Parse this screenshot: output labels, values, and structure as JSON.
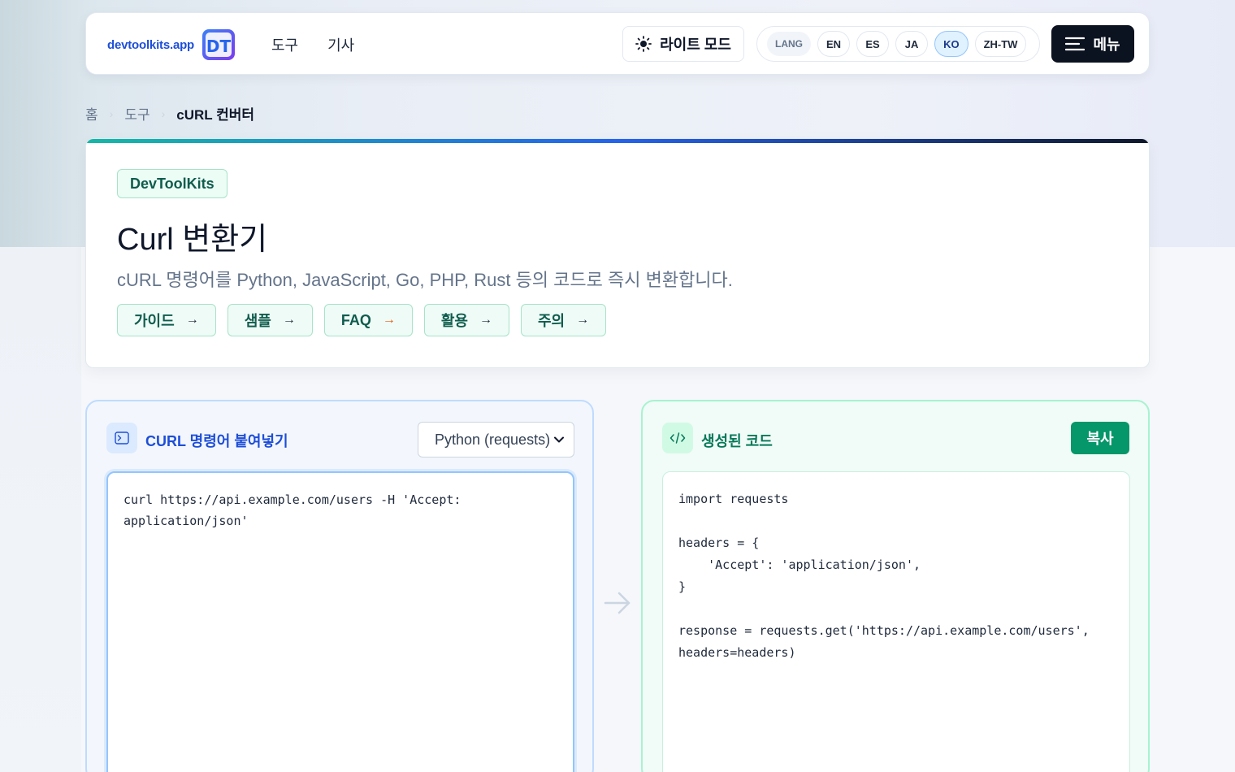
{
  "header": {
    "brand": "devtoolkits.app",
    "logo_text": "DT",
    "nav": [
      "도구",
      "기사"
    ],
    "theme_label": "라이트 모드",
    "lang_title": "LANG",
    "languages": [
      "EN",
      "ES",
      "JA",
      "KO",
      "ZH-TW"
    ],
    "active_language": "KO",
    "menu_label": "메뉴"
  },
  "breadcrumb": {
    "items": [
      "홈",
      "도구",
      "cURL 컨버터"
    ],
    "separator": "›"
  },
  "hero": {
    "badge": "DevToolKits",
    "title": "Curl 변환기",
    "description": "cURL 명령어를 Python, JavaScript, Go, PHP, Rust 등의 코드로 즉시 변환합니다.",
    "chips": [
      "가이드",
      "샘플",
      "FAQ",
      "활용",
      "주의"
    ],
    "chip_arrow": "→"
  },
  "input_panel": {
    "title": "CURL 명령어 붙여넣기",
    "selected_language": "Python (requests)",
    "curl_command": "curl https://api.example.com/users -H 'Accept: application/json'"
  },
  "output_panel": {
    "title": "생성된 코드",
    "copy_label": "복사",
    "code_lines": [
      "import requests",
      "",
      "headers = {",
      "    'Accept': 'application/json',",
      "}",
      "",
      "response = requests.get('https://api.example.com/users',",
      "headers=headers)"
    ]
  },
  "colors": {
    "brand": "#1d4ed8",
    "accent_green": "#059669",
    "accent_blue": "#93c5fd",
    "dark": "#0b1220"
  }
}
